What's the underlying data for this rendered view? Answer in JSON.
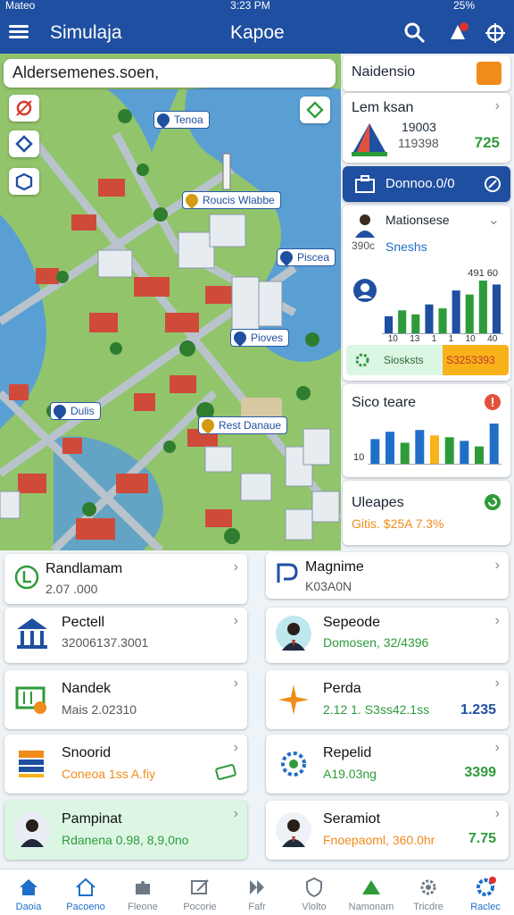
{
  "status": {
    "carrier": "Mateo",
    "time": "3:23 PM",
    "battery": "25%"
  },
  "app": {
    "title": "Simulaja",
    "center_title": "Kapoe"
  },
  "map": {
    "search_placeholder": "Aldersemenes.soen,",
    "pins": [
      {
        "label": "Tenoa",
        "gold": false
      },
      {
        "label": "Roucis Wlabbe",
        "gold": true
      },
      {
        "label": "Piscea",
        "gold": false
      },
      {
        "label": "Pioves",
        "gold": false
      },
      {
        "label": "Dulis",
        "gold": false
      },
      {
        "label": "Rest Danaue",
        "gold": false
      }
    ]
  },
  "panel": {
    "header": {
      "title": "Naidensio"
    },
    "loan": {
      "title": "Lem ksan",
      "line1": "19003",
      "line2": "119398",
      "value": "725"
    },
    "blue_bar": {
      "label": "Donnoo.0/0"
    },
    "chart1": {
      "title": "Mationsese",
      "sub1": "390c",
      "sub2": "Sneshs",
      "top_label": "491 60",
      "axis_labels": [
        "10",
        "13",
        "1",
        "1",
        "10",
        "40"
      ],
      "footer_label": "Siosksts",
      "footer_value": "S3253393",
      "values": [
        18,
        24,
        20,
        30,
        26,
        44,
        40,
        54,
        50
      ]
    },
    "chart2": {
      "title": "Sico teare",
      "axis_label": "10",
      "values": [
        28,
        36,
        24,
        38,
        32,
        30,
        26,
        20,
        45
      ]
    },
    "updates": {
      "title": "Uleapes",
      "sub": "Gitis. $25A 7.3%"
    }
  },
  "cards": [
    {
      "title": "Randlamam",
      "sub": "2.07 .000",
      "value": "",
      "green": false
    },
    {
      "title": "Magnime",
      "sub": "K03A0N",
      "value": "",
      "green": false
    },
    {
      "title": "Pectell",
      "sub": "32006137.3001",
      "value": "",
      "green": false
    },
    {
      "title": "Sepeode",
      "sub": "Domosen, 32/4396",
      "value": "",
      "green": false
    },
    {
      "title": "Nandek",
      "sub": "Mais 2.02310",
      "value": "",
      "green": false
    },
    {
      "title": "Perda",
      "sub": "2.12 1. S3ss42.1ss",
      "value": "1.235",
      "green": false
    },
    {
      "title": "Snoorid",
      "sub": "Coneoa 1ss A.fiy",
      "value": "",
      "green": false
    },
    {
      "title": "Repelid",
      "sub": "A19.03ng",
      "value": "3399",
      "green": false
    },
    {
      "title": "Pampinat",
      "sub": "Rdanena 0.98, 8,9,0no",
      "value": "",
      "green": true
    },
    {
      "title": "Seramiot",
      "sub": "Fnoepaoml, 360.0hr",
      "value": "7.75",
      "green": false
    }
  ],
  "nav": [
    {
      "label": "Daoia",
      "icon": "home-filled-icon",
      "active": true
    },
    {
      "label": "Pacoeno",
      "icon": "home-outline-icon",
      "active": true
    },
    {
      "label": "Fleone",
      "icon": "puzzle-icon",
      "active": false
    },
    {
      "label": "Pocorie",
      "icon": "edit-icon",
      "active": false
    },
    {
      "label": "Fafr",
      "icon": "play-icon",
      "active": false
    },
    {
      "label": "Vlolto",
      "icon": "shield-icon",
      "active": false
    },
    {
      "label": "Namonam",
      "icon": "tent-icon",
      "active": false
    },
    {
      "label": "Tricdre",
      "icon": "gear-icon",
      "active": false
    },
    {
      "label": "Raclec",
      "icon": "settings-badge-icon",
      "active": true
    }
  ],
  "colors": {
    "primary": "#1f4fa0",
    "accent_green": "#2e9b3a",
    "accent_orange": "#f08c1a",
    "water": "#5a9fd4"
  }
}
